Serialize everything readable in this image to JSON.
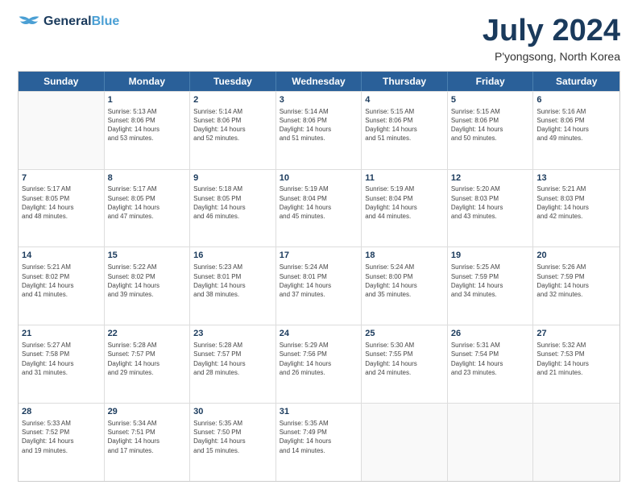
{
  "header": {
    "logo_line1": "General",
    "logo_line2": "Blue",
    "title": "July 2024",
    "subtitle": "P'yongsong, North Korea"
  },
  "calendar": {
    "days_of_week": [
      "Sunday",
      "Monday",
      "Tuesday",
      "Wednesday",
      "Thursday",
      "Friday",
      "Saturday"
    ],
    "weeks": [
      [
        {
          "day": "",
          "info": ""
        },
        {
          "day": "1",
          "info": "Sunrise: 5:13 AM\nSunset: 8:06 PM\nDaylight: 14 hours\nand 53 minutes."
        },
        {
          "day": "2",
          "info": "Sunrise: 5:14 AM\nSunset: 8:06 PM\nDaylight: 14 hours\nand 52 minutes."
        },
        {
          "day": "3",
          "info": "Sunrise: 5:14 AM\nSunset: 8:06 PM\nDaylight: 14 hours\nand 51 minutes."
        },
        {
          "day": "4",
          "info": "Sunrise: 5:15 AM\nSunset: 8:06 PM\nDaylight: 14 hours\nand 51 minutes."
        },
        {
          "day": "5",
          "info": "Sunrise: 5:15 AM\nSunset: 8:06 PM\nDaylight: 14 hours\nand 50 minutes."
        },
        {
          "day": "6",
          "info": "Sunrise: 5:16 AM\nSunset: 8:06 PM\nDaylight: 14 hours\nand 49 minutes."
        }
      ],
      [
        {
          "day": "7",
          "info": "Sunrise: 5:17 AM\nSunset: 8:05 PM\nDaylight: 14 hours\nand 48 minutes."
        },
        {
          "day": "8",
          "info": "Sunrise: 5:17 AM\nSunset: 8:05 PM\nDaylight: 14 hours\nand 47 minutes."
        },
        {
          "day": "9",
          "info": "Sunrise: 5:18 AM\nSunset: 8:05 PM\nDaylight: 14 hours\nand 46 minutes."
        },
        {
          "day": "10",
          "info": "Sunrise: 5:19 AM\nSunset: 8:04 PM\nDaylight: 14 hours\nand 45 minutes."
        },
        {
          "day": "11",
          "info": "Sunrise: 5:19 AM\nSunset: 8:04 PM\nDaylight: 14 hours\nand 44 minutes."
        },
        {
          "day": "12",
          "info": "Sunrise: 5:20 AM\nSunset: 8:03 PM\nDaylight: 14 hours\nand 43 minutes."
        },
        {
          "day": "13",
          "info": "Sunrise: 5:21 AM\nSunset: 8:03 PM\nDaylight: 14 hours\nand 42 minutes."
        }
      ],
      [
        {
          "day": "14",
          "info": "Sunrise: 5:21 AM\nSunset: 8:02 PM\nDaylight: 14 hours\nand 41 minutes."
        },
        {
          "day": "15",
          "info": "Sunrise: 5:22 AM\nSunset: 8:02 PM\nDaylight: 14 hours\nand 39 minutes."
        },
        {
          "day": "16",
          "info": "Sunrise: 5:23 AM\nSunset: 8:01 PM\nDaylight: 14 hours\nand 38 minutes."
        },
        {
          "day": "17",
          "info": "Sunrise: 5:24 AM\nSunset: 8:01 PM\nDaylight: 14 hours\nand 37 minutes."
        },
        {
          "day": "18",
          "info": "Sunrise: 5:24 AM\nSunset: 8:00 PM\nDaylight: 14 hours\nand 35 minutes."
        },
        {
          "day": "19",
          "info": "Sunrise: 5:25 AM\nSunset: 7:59 PM\nDaylight: 14 hours\nand 34 minutes."
        },
        {
          "day": "20",
          "info": "Sunrise: 5:26 AM\nSunset: 7:59 PM\nDaylight: 14 hours\nand 32 minutes."
        }
      ],
      [
        {
          "day": "21",
          "info": "Sunrise: 5:27 AM\nSunset: 7:58 PM\nDaylight: 14 hours\nand 31 minutes."
        },
        {
          "day": "22",
          "info": "Sunrise: 5:28 AM\nSunset: 7:57 PM\nDaylight: 14 hours\nand 29 minutes."
        },
        {
          "day": "23",
          "info": "Sunrise: 5:28 AM\nSunset: 7:57 PM\nDaylight: 14 hours\nand 28 minutes."
        },
        {
          "day": "24",
          "info": "Sunrise: 5:29 AM\nSunset: 7:56 PM\nDaylight: 14 hours\nand 26 minutes."
        },
        {
          "day": "25",
          "info": "Sunrise: 5:30 AM\nSunset: 7:55 PM\nDaylight: 14 hours\nand 24 minutes."
        },
        {
          "day": "26",
          "info": "Sunrise: 5:31 AM\nSunset: 7:54 PM\nDaylight: 14 hours\nand 23 minutes."
        },
        {
          "day": "27",
          "info": "Sunrise: 5:32 AM\nSunset: 7:53 PM\nDaylight: 14 hours\nand 21 minutes."
        }
      ],
      [
        {
          "day": "28",
          "info": "Sunrise: 5:33 AM\nSunset: 7:52 PM\nDaylight: 14 hours\nand 19 minutes."
        },
        {
          "day": "29",
          "info": "Sunrise: 5:34 AM\nSunset: 7:51 PM\nDaylight: 14 hours\nand 17 minutes."
        },
        {
          "day": "30",
          "info": "Sunrise: 5:35 AM\nSunset: 7:50 PM\nDaylight: 14 hours\nand 15 minutes."
        },
        {
          "day": "31",
          "info": "Sunrise: 5:35 AM\nSunset: 7:49 PM\nDaylight: 14 hours\nand 14 minutes."
        },
        {
          "day": "",
          "info": ""
        },
        {
          "day": "",
          "info": ""
        },
        {
          "day": "",
          "info": ""
        }
      ]
    ]
  }
}
